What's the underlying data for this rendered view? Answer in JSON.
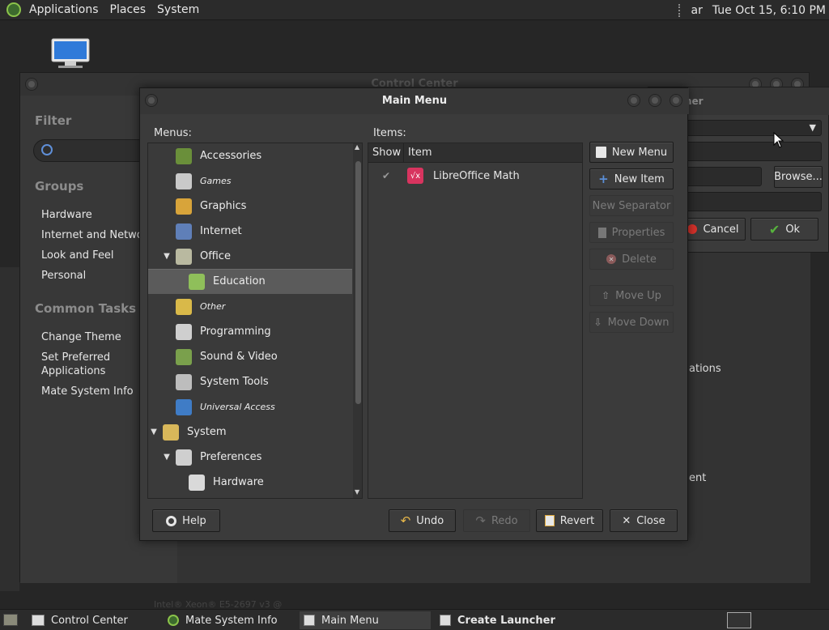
{
  "top_panel": {
    "menus": [
      "Applications",
      "Places",
      "System"
    ],
    "keyboard": "ar",
    "clock": "Tue Oct 15,  6:10 PM"
  },
  "control_center": {
    "title": "Control Center",
    "filter_heading": "Filter",
    "groups_heading": "Groups",
    "groups": [
      "Hardware",
      "Internet and Network",
      "Look and Feel",
      "Personal"
    ],
    "common_tasks_heading": "Common Tasks",
    "tasks": [
      "Change Theme",
      "Set Preferred Applications",
      "Mate System Info"
    ],
    "clipped_text": [
      "ations",
      "ent"
    ]
  },
  "create_launcher": {
    "title_fragment": "her",
    "browse_label": "Browse...",
    "cancel_label": "Cancel",
    "ok_label": "Ok"
  },
  "main_menu": {
    "title": "Main Menu",
    "menus_label": "Menus:",
    "items_label": "Items:",
    "tree": [
      {
        "label": "Accessories",
        "italic": false,
        "expander": "",
        "indent": 0,
        "icon": "accessories-icon",
        "color": "#6a8f3a"
      },
      {
        "label": "Games",
        "italic": true,
        "expander": "",
        "indent": 0,
        "icon": "games-icon",
        "color": "#c9c9c9"
      },
      {
        "label": "Graphics",
        "italic": false,
        "expander": "",
        "indent": 0,
        "icon": "graphics-icon",
        "color": "#d8a43a"
      },
      {
        "label": "Internet",
        "italic": false,
        "expander": "",
        "indent": 0,
        "icon": "internet-icon",
        "color": "#5f7fb8"
      },
      {
        "label": "Office",
        "italic": false,
        "expander": "▼",
        "indent": 0,
        "icon": "office-icon",
        "color": "#b9b9a0"
      },
      {
        "label": "Education",
        "italic": false,
        "expander": "",
        "indent": 1,
        "icon": "education-icon",
        "color": "#8fbf5a",
        "selected": true
      },
      {
        "label": "Other",
        "italic": true,
        "expander": "",
        "indent": 0,
        "icon": "other-icon",
        "color": "#d9b949"
      },
      {
        "label": "Programming",
        "italic": false,
        "expander": "",
        "indent": 0,
        "icon": "programming-icon",
        "color": "#cfcfcf"
      },
      {
        "label": "Sound & Video",
        "italic": false,
        "expander": "",
        "indent": 0,
        "icon": "sound-video-icon",
        "color": "#7aa04c"
      },
      {
        "label": "System Tools",
        "italic": false,
        "expander": "",
        "indent": 0,
        "icon": "system-tools-icon",
        "color": "#bdbdbd"
      },
      {
        "label": "Universal Access",
        "italic": true,
        "expander": "",
        "indent": 0,
        "icon": "universal-access-icon",
        "color": "#3f7cc6"
      },
      {
        "label": "System",
        "italic": false,
        "expander": "▼",
        "indent": -1,
        "icon": "system-icon",
        "color": "#d8b75a"
      },
      {
        "label": "Preferences",
        "italic": false,
        "expander": "▼",
        "indent": 0,
        "icon": "preferences-icon",
        "color": "#cfcfcf"
      },
      {
        "label": "Hardware",
        "italic": false,
        "expander": "",
        "indent": 1,
        "icon": "hardware-icon",
        "color": "#d9d9d9"
      }
    ],
    "items_columns": [
      "Show",
      "Item"
    ],
    "items": [
      {
        "show": "✔",
        "label": "LibreOffice Math"
      }
    ],
    "side_buttons": {
      "new_menu": "New Menu",
      "new_item": "New Item",
      "new_separator": "New Separator",
      "properties": "Properties",
      "delete": "Delete",
      "move_up": "Move Up",
      "move_down": "Move Down"
    },
    "bottom_buttons": {
      "help": "Help",
      "undo": "Undo",
      "redo": "Redo",
      "revert": "Revert",
      "close": "Close"
    }
  },
  "taskbar": {
    "tasks": [
      "Control Center",
      "Mate System Info",
      "Main Menu",
      "Create Launcher"
    ],
    "hidden_text": "Intel® Xeon® E5-2697 v3 @ "
  },
  "colors": {
    "accent_green": "#57b33d",
    "selected_row": "#5b5b5b",
    "math_icon": "#d8345f"
  }
}
